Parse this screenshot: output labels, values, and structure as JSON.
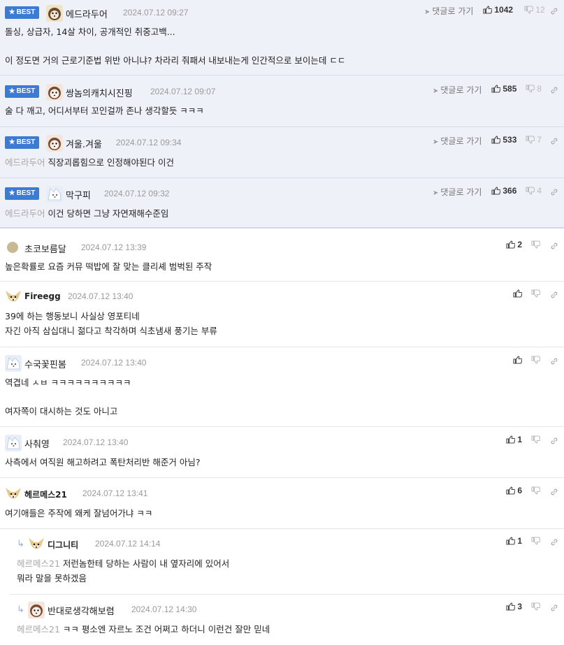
{
  "best_badge": "BEST",
  "reply_go_label": "댓글로 가기",
  "best_comments": [
    {
      "nick": "에드라두어",
      "date": "2024.07.12 09:27",
      "up": "1042",
      "down": "12",
      "mention": "",
      "lines": [
        "돌싱, 상급자, 14살 차이, 공개적인 취중고백...",
        "",
        "이 정도면 거의 근로기준법 위반 아니냐? 차라리 줘패서 내보내는게 인간적으로 보이는데 ㄷㄷ"
      ]
    },
    {
      "nick": "쌍놈의캐치시진핑",
      "date": "2024.07.12 09:07",
      "up": "585",
      "down": "8",
      "mention": "",
      "lines": [
        "술 다 깨고, 어디서부터 꼬인걸까 존나 생각할듯 ㅋㅋㅋ"
      ]
    },
    {
      "nick": "겨울.겨울",
      "date": "2024.07.12 09:34",
      "up": "533",
      "down": "7",
      "mention": "에드라두어",
      "lines": [
        "직장괴롭힘으로 인정해야된다 이건"
      ]
    },
    {
      "nick": "막구피",
      "date": "2024.07.12 09:32",
      "up": "366",
      "down": "4",
      "mention": "에드라두어",
      "lines": [
        "이건 당하면 그냥 자연재해수준임"
      ]
    }
  ],
  "comments": [
    {
      "nick": "초코보름달",
      "date": "2024.07.12 13:39",
      "up": "2",
      "mention": "",
      "lines": [
        "높은확률로 요즘 커뮤 떡밥에 잘 맞는 클리셰 범벅된 주작"
      ]
    },
    {
      "nick": "Fireegg",
      "date": "2024.07.12 13:40",
      "up": "",
      "mention": "",
      "lines": [
        "39에 하는 행동보니 사실상 영포티네",
        "자긴 아직 삼십대니 젊다고 착각하며 식초냄새 풍기는 부류"
      ]
    },
    {
      "nick": "수국꽃핀봄",
      "date": "2024.07.12 13:40",
      "up": "",
      "mention": "",
      "lines": [
        "역겹네 ㅅㅂ ㅋㅋㅋㅋㅋㅋㅋㅋㅋㅋ",
        "",
        "여자쪽이 대시하는 것도 아니고"
      ]
    },
    {
      "nick": "사춰영",
      "date": "2024.07.12 13:40",
      "up": "1",
      "mention": "",
      "lines": [
        "사측에서 여직원 해고하려고 폭탄처리반 해준거 아님?"
      ]
    },
    {
      "nick": "헤르메스21",
      "date": "2024.07.12 13:41",
      "up": "6",
      "mention": "",
      "lines": [
        "여기애들은 주작에 왜케 잘넘어가냐 ㅋㅋ"
      ]
    },
    {
      "nick": "디그니티",
      "date": "2024.07.12 14:14",
      "up": "1",
      "mention": "헤르메스21",
      "lines": [
        "저런놈한테 당하는 사람이 내 옆자리에 있어서",
        "뭐라 말을 못하겠음"
      ]
    },
    {
      "nick": "반대로생각해보렴",
      "date": "2024.07.12 14:30",
      "up": "3",
      "mention": "헤르메스21",
      "lines": [
        "ㅋㅋ 평소엔 자르노 조건 어쩌고 하더니 이런건 잘만 믿네"
      ]
    }
  ],
  "colors": {
    "badge": "#3c7bd4",
    "best_bg": "#eef1f8",
    "mention": "#a8a8a8",
    "date": "#9a9a9a"
  }
}
